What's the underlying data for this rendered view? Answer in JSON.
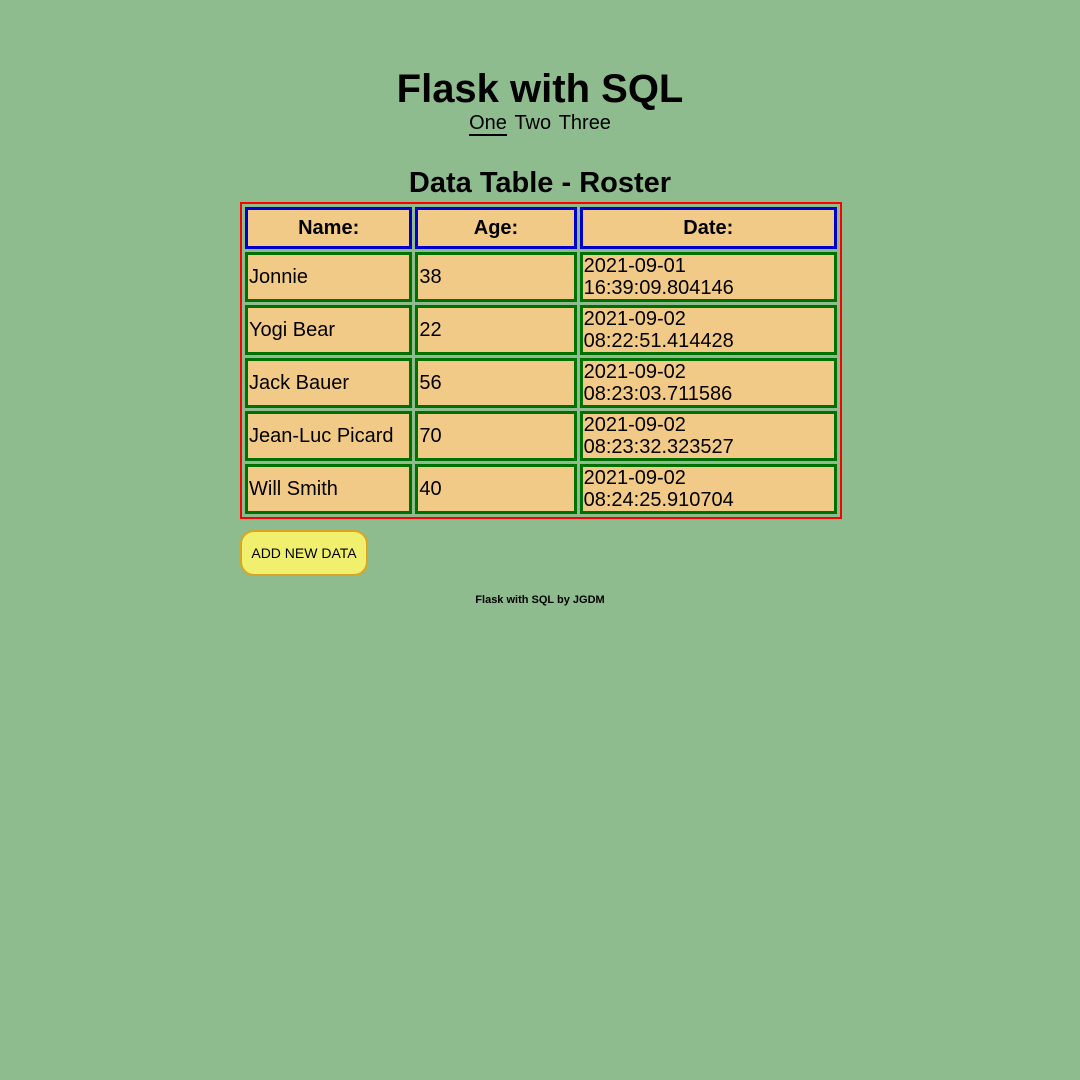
{
  "header": {
    "title": "Flask with SQL",
    "nav": [
      {
        "label": "One",
        "active": true
      },
      {
        "label": "Two",
        "active": false
      },
      {
        "label": "Three",
        "active": false
      }
    ]
  },
  "table": {
    "title": "Data Table - Roster",
    "columns": [
      "Name:",
      "Age:",
      "Date:"
    ],
    "rows": [
      {
        "name": "Jonnie",
        "age": "38",
        "date": "2021-09-01",
        "time": "16:39:09.804146"
      },
      {
        "name": "Yogi Bear",
        "age": "22",
        "date": "2021-09-02",
        "time": "08:22:51.414428"
      },
      {
        "name": "Jack Bauer",
        "age": "56",
        "date": "2021-09-02",
        "time": "08:23:03.711586"
      },
      {
        "name": "Jean-Luc Picard",
        "age": "70",
        "date": "2021-09-02",
        "time": "08:23:32.323527"
      },
      {
        "name": "Will Smith",
        "age": "40",
        "date": "2021-09-02",
        "time": "08:24:25.910704"
      }
    ]
  },
  "actions": {
    "add_label": "ADD NEW DATA"
  },
  "footer": {
    "text": "Flask with SQL by JGDM"
  },
  "colors": {
    "background": "#8fbc8f",
    "cell": "#f2ca87",
    "table_border": "#ff0000",
    "header_border": "#0000cc",
    "cell_border": "#007000",
    "button": "#f0f06e"
  }
}
